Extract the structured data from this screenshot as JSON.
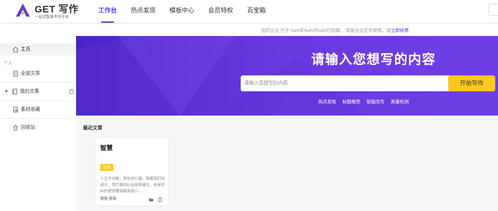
{
  "brand": {
    "title": "GET 写作",
    "subtitle": "一站式智能写作平台"
  },
  "nav": {
    "items": [
      {
        "label": "工作台",
        "active": true
      },
      {
        "label": "热点发现",
        "active": false
      },
      {
        "label": "模板中心",
        "active": false
      },
      {
        "label": "会员特权",
        "active": false
      },
      {
        "label": "百宝箱",
        "active": false
      }
    ]
  },
  "notice": {
    "text": "您的企业   已于   NaN年NaN月NaN日到期，   恢复企业正常使用，请",
    "link": "立即续费"
  },
  "sidebar": {
    "home": "主页",
    "group_label": "个人",
    "all_articles": "全部文章",
    "my_library": "我的文集",
    "material": "素材收藏",
    "trash": "回收站"
  },
  "hero": {
    "title": "请输入您想写的内容",
    "input_placeholder": "请输入您想写的内容",
    "button": "开始写作",
    "links": [
      "热点发现",
      "标题推荐",
      "智能改写",
      "质量检测"
    ],
    "accent": "#5b3fe6",
    "button_color": "#ffc81f"
  },
  "recent": {
    "title": "最近文章",
    "card": {
      "title": "智慧",
      "tag": "智慧",
      "body": "人生不怕晚，那知进行着。随着我们的成长，我们面向社会越来越大，但是实际的是想要回越来越少。...",
      "footer": "刚刚 更新"
    }
  }
}
